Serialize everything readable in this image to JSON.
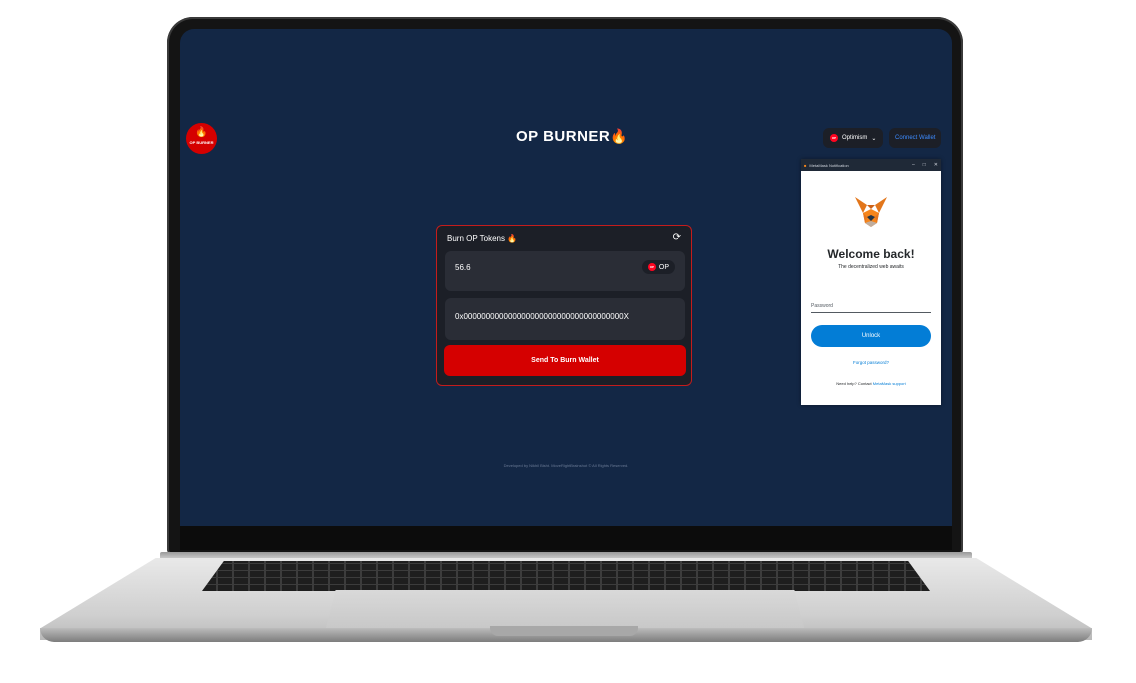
{
  "app": {
    "logo_text": "OP BURNER",
    "brand": "OP BURNER",
    "network_label": "Optimism",
    "network_icon_text": "OP",
    "connect_label": "Connect Wallet"
  },
  "burn_card": {
    "title": "Burn OP Tokens",
    "amount": "56.6",
    "token": "OP",
    "address": "0x000000000000000000000000000000000000X",
    "send_label": "Send To Burn Wallet"
  },
  "footer": {
    "text": "Developed by Nikhil Bisht. MoveRightBrainshot © All Rights Reserved."
  },
  "metamask": {
    "window_title": "MetaMask Notification",
    "title": "Welcome back!",
    "subtitle": "The decentralized web awaits",
    "password_label": "Password",
    "unlock_label": "Unlock",
    "forgot_label": "Forgot password?",
    "help_prefix": "Need help? Contact",
    "help_link": "MetaMask support"
  },
  "colors": {
    "screen_bg": "#132745",
    "accent_red": "#d50000",
    "metamask_blue": "#037dd6"
  }
}
